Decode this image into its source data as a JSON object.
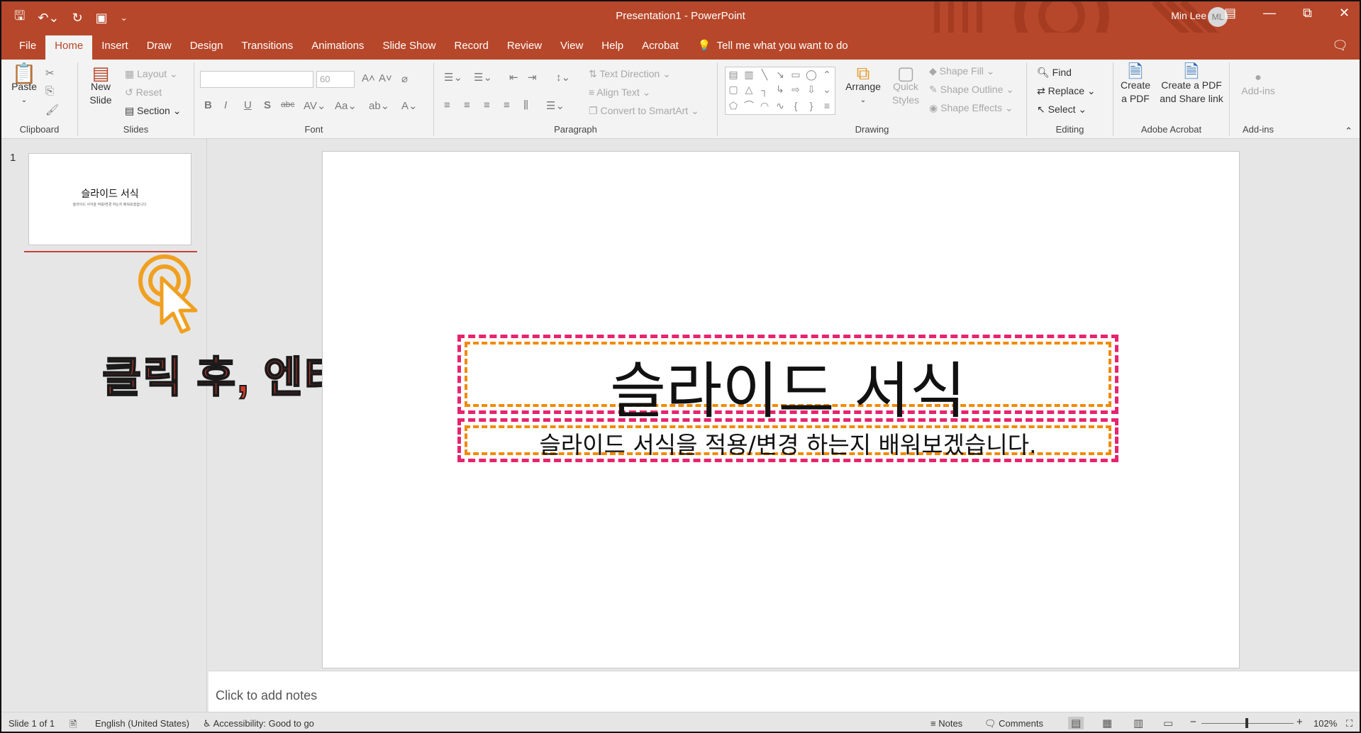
{
  "titlebar": {
    "title": "Presentation1  -  PowerPoint",
    "user": "Min Lee",
    "initials": "ML"
  },
  "tabs": [
    {
      "label": "File"
    },
    {
      "label": "Home"
    },
    {
      "label": "Insert"
    },
    {
      "label": "Draw"
    },
    {
      "label": "Design"
    },
    {
      "label": "Transitions"
    },
    {
      "label": "Animations"
    },
    {
      "label": "Slide Show"
    },
    {
      "label": "Record"
    },
    {
      "label": "Review"
    },
    {
      "label": "View"
    },
    {
      "label": "Help"
    },
    {
      "label": "Acrobat"
    }
  ],
  "tell_me": "Tell me what you want to do",
  "ribbon": {
    "clipboard": {
      "label": "Clipboard",
      "paste": "Paste"
    },
    "slides": {
      "label": "Slides",
      "new_slide_1": "New",
      "new_slide_2": "Slide",
      "layout": "Layout",
      "reset": "Reset",
      "section": "Section"
    },
    "font": {
      "label": "Font",
      "size": "60"
    },
    "paragraph": {
      "label": "Paragraph",
      "text_direction": "Text Direction",
      "align_text": "Align Text",
      "smartart": "Convert to SmartArt"
    },
    "drawing": {
      "label": "Drawing",
      "arrange": "Arrange",
      "quick_styles_1": "Quick",
      "quick_styles_2": "Styles",
      "shape_fill": "Shape Fill",
      "shape_outline": "Shape Outline",
      "shape_effects": "Shape Effects"
    },
    "editing": {
      "label": "Editing",
      "find": "Find",
      "replace": "Replace",
      "select": "Select"
    },
    "acrobat": {
      "label": "Adobe Acrobat",
      "create_pdf_1": "Create",
      "create_pdf_2": "a PDF",
      "share_1": "Create a PDF",
      "share_2": "and Share link"
    },
    "addins": {
      "label": "Add-ins",
      "addins_btn": "Add-ins"
    }
  },
  "slides_panel": {
    "slide_number": "1",
    "thumb_title": "슬라이드 서식",
    "thumb_subtitle": "슬라이드 서식을 적용/변경 하는지 배워보겠습니다.",
    "annotation": "클릭 후, 엔터"
  },
  "slide": {
    "title": "슬라이드 서식",
    "subtitle": "슬라이드 서식을 적용/변경 하는지 배워보겠습니다."
  },
  "notes_placeholder": "Click to add notes",
  "statusbar": {
    "slide_info": "Slide 1 of 1",
    "language": "English (United States)",
    "accessibility": "Accessibility: Good to go",
    "notes": "Notes",
    "comments": "Comments",
    "zoom": "102%"
  },
  "colors": {
    "accent": "#b7472a",
    "title_border": "#e6256e",
    "inner_border": "#f18a00",
    "annotation": "#d23a2a"
  }
}
